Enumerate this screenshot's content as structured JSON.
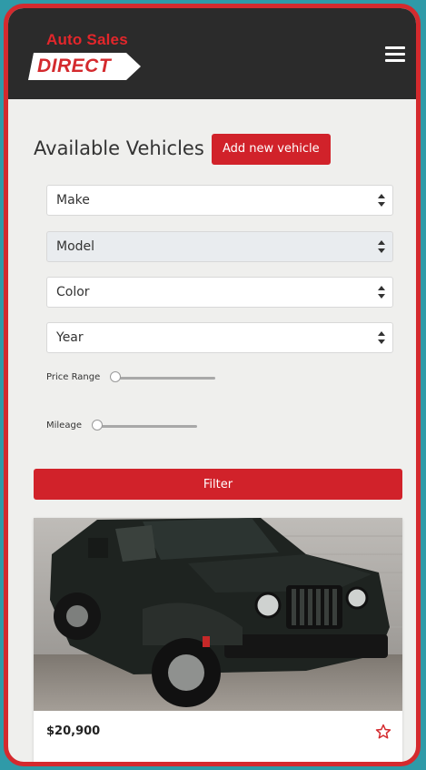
{
  "brand": {
    "top_text": "Auto Sales",
    "word": "DIRECT",
    "accent_color": "#d42a2e",
    "header_bg": "#2b2b2b"
  },
  "header": {
    "menu_icon": "hamburger-menu-icon"
  },
  "main": {
    "title": "Available Vehicles",
    "add_button_label": "Add new vehicle",
    "filters": {
      "make": {
        "value": "Make"
      },
      "model": {
        "value": "Model",
        "disabled": true
      },
      "color": {
        "value": "Color"
      },
      "year": {
        "value": "Year"
      },
      "price_range": {
        "label": "Price Range",
        "level": 0
      },
      "mileage": {
        "label": "Mileage",
        "level": 0
      }
    },
    "filter_button_label": "Filter"
  },
  "listing": {
    "price": "$20,900",
    "favorite_icon": "star-outline-icon"
  }
}
